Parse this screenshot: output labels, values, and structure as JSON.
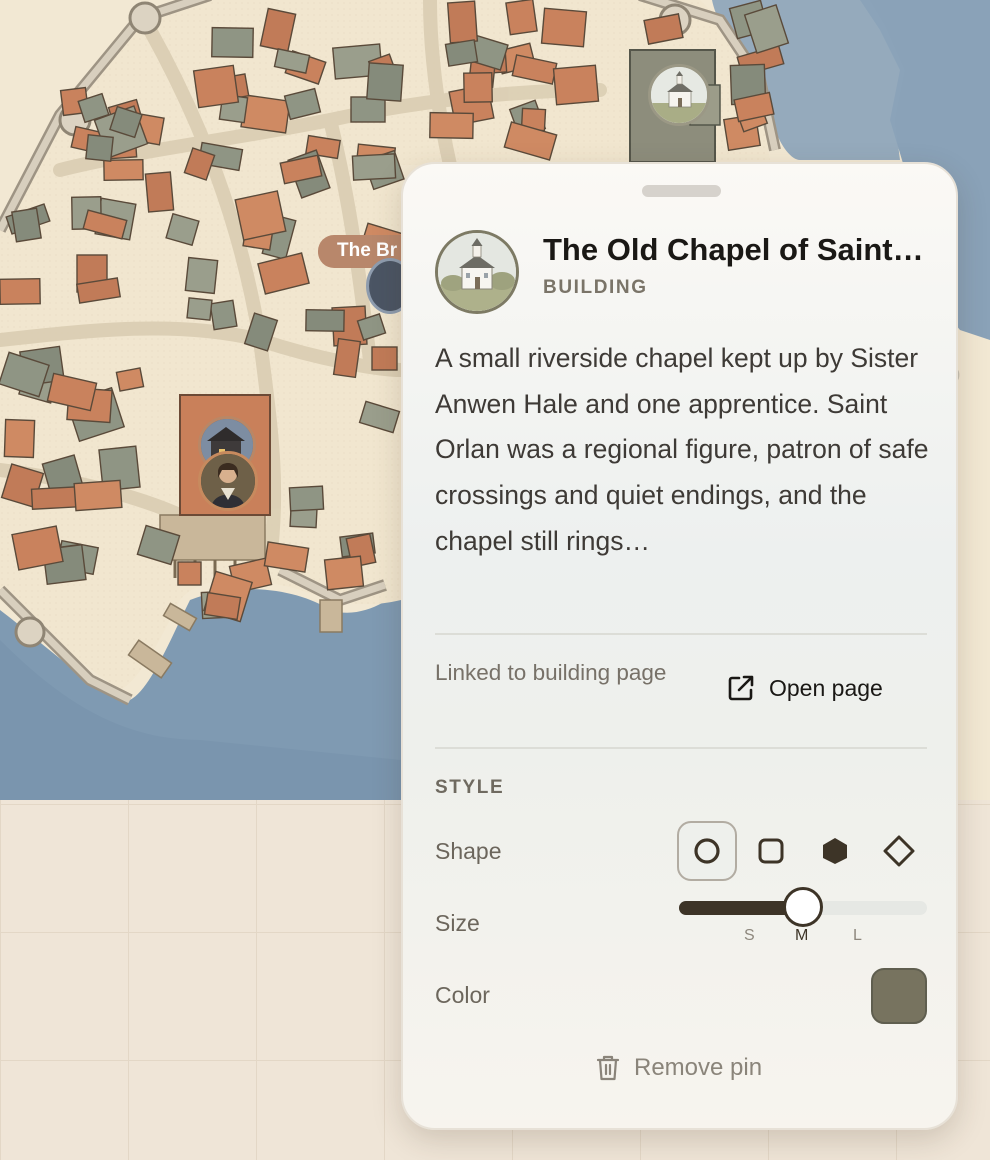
{
  "map": {
    "visible_label": "The Br"
  },
  "popover": {
    "title": "The Old Chapel of Saint Orlan",
    "type_label": "BUILDING",
    "description": "A small riverside chapel kept up by Sister Anwen Hale and one apprentice. Saint Orlan was a regional figure, patron of safe crossings and quiet endings, and the chapel still rings…",
    "linked_text": "Linked to building page",
    "open_label": "Open page",
    "style_heading": "STYLE",
    "shape_label": "Shape",
    "size_label": "Size",
    "color_label": "Color",
    "shapes": [
      "circle",
      "square",
      "hexagon",
      "diamond"
    ],
    "selected_shape": "circle",
    "size_ticks": [
      "S",
      "M",
      "L"
    ],
    "selected_size": "M",
    "size_level": 0.5,
    "color": "#77735f",
    "remove_label": "Remove pin"
  }
}
